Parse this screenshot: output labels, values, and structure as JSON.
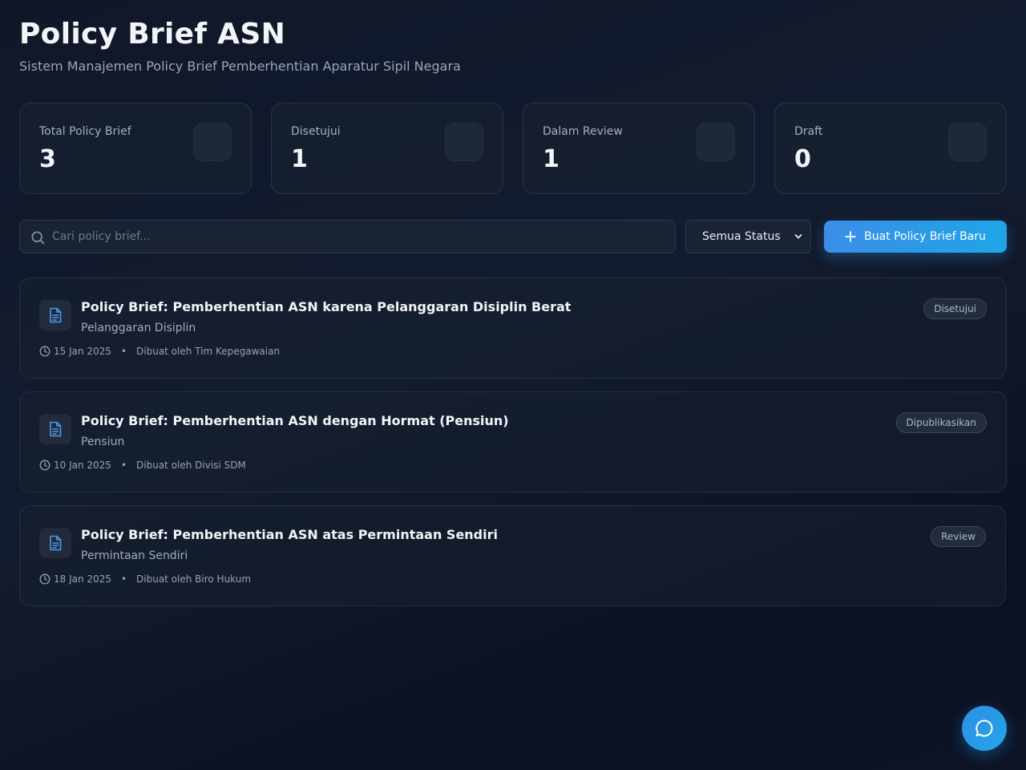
{
  "header": {
    "title": "Policy Brief ASN",
    "subtitle": "Sistem Manajemen Policy Brief Pemberhentian Aparatur Sipil Negara"
  },
  "stats": [
    {
      "label": "Total Policy Brief",
      "value": "3"
    },
    {
      "label": "Disetujui",
      "value": "1"
    },
    {
      "label": "Dalam Review",
      "value": "1"
    },
    {
      "label": "Draft",
      "value": "0"
    }
  ],
  "toolbar": {
    "search_placeholder": "Cari policy brief...",
    "status_filter": "Semua Status",
    "new_button_label": "Buat Policy Brief Baru"
  },
  "briefs": [
    {
      "title": "Policy Brief: Pemberhentian ASN karena Pelanggaran Disiplin Berat",
      "category": "Pelanggaran Disiplin",
      "date": "15 Jan 2025",
      "author": "Dibuat oleh Tim Kepegawaian",
      "status": "Disetujui"
    },
    {
      "title": "Policy Brief: Pemberhentian ASN dengan Hormat (Pensiun)",
      "category": "Pensiun",
      "date": "10 Jan 2025",
      "author": "Dibuat oleh Divisi SDM",
      "status": "Dipublikasikan"
    },
    {
      "title": "Policy Brief: Pemberhentian ASN atas Permintaan Sendiri",
      "category": "Permintaan Sendiri",
      "date": "18 Jan 2025",
      "author": "Dibuat oleh Biro Hukum",
      "status": "Review"
    }
  ],
  "meta_separator": "•",
  "colors": {
    "accent": "#3b8ee8",
    "background": "#0f1729"
  }
}
